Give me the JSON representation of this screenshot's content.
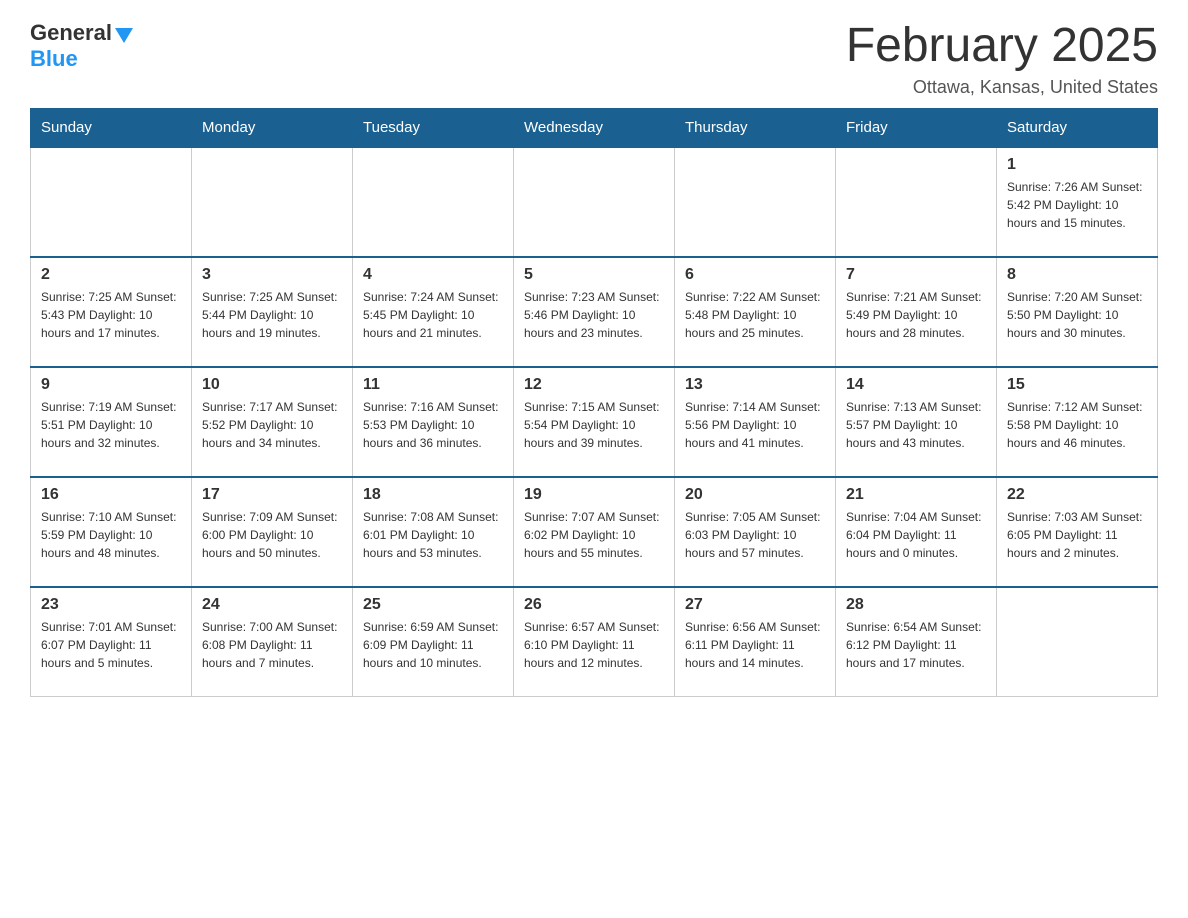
{
  "logo": {
    "general": "General",
    "blue": "Blue"
  },
  "header": {
    "title": "February 2025",
    "location": "Ottawa, Kansas, United States"
  },
  "days_of_week": [
    "Sunday",
    "Monday",
    "Tuesday",
    "Wednesday",
    "Thursday",
    "Friday",
    "Saturday"
  ],
  "weeks": [
    [
      {
        "day": "",
        "info": ""
      },
      {
        "day": "",
        "info": ""
      },
      {
        "day": "",
        "info": ""
      },
      {
        "day": "",
        "info": ""
      },
      {
        "day": "",
        "info": ""
      },
      {
        "day": "",
        "info": ""
      },
      {
        "day": "1",
        "info": "Sunrise: 7:26 AM\nSunset: 5:42 PM\nDaylight: 10 hours and 15 minutes."
      }
    ],
    [
      {
        "day": "2",
        "info": "Sunrise: 7:25 AM\nSunset: 5:43 PM\nDaylight: 10 hours and 17 minutes."
      },
      {
        "day": "3",
        "info": "Sunrise: 7:25 AM\nSunset: 5:44 PM\nDaylight: 10 hours and 19 minutes."
      },
      {
        "day": "4",
        "info": "Sunrise: 7:24 AM\nSunset: 5:45 PM\nDaylight: 10 hours and 21 minutes."
      },
      {
        "day": "5",
        "info": "Sunrise: 7:23 AM\nSunset: 5:46 PM\nDaylight: 10 hours and 23 minutes."
      },
      {
        "day": "6",
        "info": "Sunrise: 7:22 AM\nSunset: 5:48 PM\nDaylight: 10 hours and 25 minutes."
      },
      {
        "day": "7",
        "info": "Sunrise: 7:21 AM\nSunset: 5:49 PM\nDaylight: 10 hours and 28 minutes."
      },
      {
        "day": "8",
        "info": "Sunrise: 7:20 AM\nSunset: 5:50 PM\nDaylight: 10 hours and 30 minutes."
      }
    ],
    [
      {
        "day": "9",
        "info": "Sunrise: 7:19 AM\nSunset: 5:51 PM\nDaylight: 10 hours and 32 minutes."
      },
      {
        "day": "10",
        "info": "Sunrise: 7:17 AM\nSunset: 5:52 PM\nDaylight: 10 hours and 34 minutes."
      },
      {
        "day": "11",
        "info": "Sunrise: 7:16 AM\nSunset: 5:53 PM\nDaylight: 10 hours and 36 minutes."
      },
      {
        "day": "12",
        "info": "Sunrise: 7:15 AM\nSunset: 5:54 PM\nDaylight: 10 hours and 39 minutes."
      },
      {
        "day": "13",
        "info": "Sunrise: 7:14 AM\nSunset: 5:56 PM\nDaylight: 10 hours and 41 minutes."
      },
      {
        "day": "14",
        "info": "Sunrise: 7:13 AM\nSunset: 5:57 PM\nDaylight: 10 hours and 43 minutes."
      },
      {
        "day": "15",
        "info": "Sunrise: 7:12 AM\nSunset: 5:58 PM\nDaylight: 10 hours and 46 minutes."
      }
    ],
    [
      {
        "day": "16",
        "info": "Sunrise: 7:10 AM\nSunset: 5:59 PM\nDaylight: 10 hours and 48 minutes."
      },
      {
        "day": "17",
        "info": "Sunrise: 7:09 AM\nSunset: 6:00 PM\nDaylight: 10 hours and 50 minutes."
      },
      {
        "day": "18",
        "info": "Sunrise: 7:08 AM\nSunset: 6:01 PM\nDaylight: 10 hours and 53 minutes."
      },
      {
        "day": "19",
        "info": "Sunrise: 7:07 AM\nSunset: 6:02 PM\nDaylight: 10 hours and 55 minutes."
      },
      {
        "day": "20",
        "info": "Sunrise: 7:05 AM\nSunset: 6:03 PM\nDaylight: 10 hours and 57 minutes."
      },
      {
        "day": "21",
        "info": "Sunrise: 7:04 AM\nSunset: 6:04 PM\nDaylight: 11 hours and 0 minutes."
      },
      {
        "day": "22",
        "info": "Sunrise: 7:03 AM\nSunset: 6:05 PM\nDaylight: 11 hours and 2 minutes."
      }
    ],
    [
      {
        "day": "23",
        "info": "Sunrise: 7:01 AM\nSunset: 6:07 PM\nDaylight: 11 hours and 5 minutes."
      },
      {
        "day": "24",
        "info": "Sunrise: 7:00 AM\nSunset: 6:08 PM\nDaylight: 11 hours and 7 minutes."
      },
      {
        "day": "25",
        "info": "Sunrise: 6:59 AM\nSunset: 6:09 PM\nDaylight: 11 hours and 10 minutes."
      },
      {
        "day": "26",
        "info": "Sunrise: 6:57 AM\nSunset: 6:10 PM\nDaylight: 11 hours and 12 minutes."
      },
      {
        "day": "27",
        "info": "Sunrise: 6:56 AM\nSunset: 6:11 PM\nDaylight: 11 hours and 14 minutes."
      },
      {
        "day": "28",
        "info": "Sunrise: 6:54 AM\nSunset: 6:12 PM\nDaylight: 11 hours and 17 minutes."
      },
      {
        "day": "",
        "info": ""
      }
    ]
  ]
}
